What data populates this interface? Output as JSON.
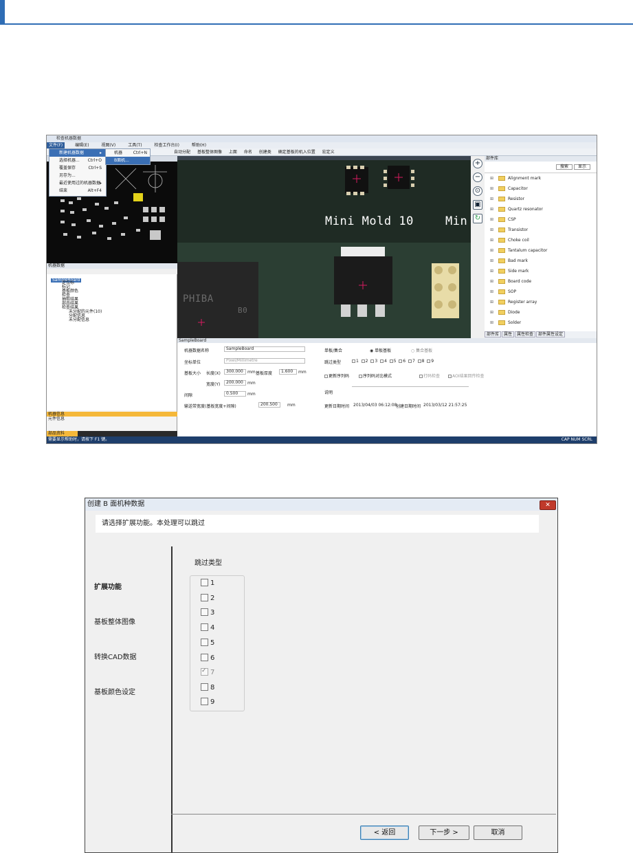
{
  "colors": {
    "accent": "#2f6db5",
    "highlight": "#f5b83a",
    "close_button": "#c0392b"
  },
  "screenshot_top": {
    "app_title": "检查机器数据",
    "menubar": [
      "文件(F)",
      "编辑(E)",
      "视图(V)",
      "工具(T)",
      "检查工作台(I)",
      "帮助(H)"
    ],
    "toolbar": [
      "自动分配",
      "基板整体图像",
      "上面",
      "命名",
      "创建类",
      "确定基板的机入位置",
      "宏定义"
    ],
    "file_menu": [
      {
        "label": "新建机器数据",
        "shortcut": ""
      },
      {
        "label": "选择机器...",
        "shortcut": "Ctrl+O"
      },
      {
        "label": "覆盖保存",
        "shortcut": "Ctrl+S"
      },
      {
        "label": "另存为...",
        "shortcut": ""
      },
      {
        "label": "最近使用过的机器数据",
        "shortcut": ""
      },
      {
        "label": "结束",
        "shortcut": "Alt+F4"
      }
    ],
    "submenu": [
      {
        "label": "机器",
        "shortcut": "Ctrl+N"
      },
      {
        "label": "B面机...",
        "shortcut": ""
      }
    ],
    "tree_panel_title": "机器数据",
    "tree": [
      "SampleBoard",
      "定位标",
      "标记",
      "基板颜色",
      "检查",
      "抽取结果",
      "部品结果",
      "检查结果",
      "未分配的元件(10)",
      "分配信息",
      "未分配信息"
    ],
    "status_panel": {
      "item1": "机器信息",
      "item2": "元件信息"
    },
    "bottom_tab": "部品资料",
    "statusbar_left": "需要显示帮助时，请按下 F1 键。",
    "statusbar_right": "CAP NUM SCRL",
    "silkscreen": [
      "Mini Mold 10",
      "Min",
      "PHIBA",
      "B0"
    ],
    "library_title": "部件库",
    "search_label": "搜索",
    "display_label": "显示",
    "library_items": [
      "Alignment mark",
      "Capacitor",
      "Resistor",
      "Quartz resonator",
      "CSP",
      "Transistor",
      "Choke coil",
      "Tantalum capacitor",
      "Bad mark",
      "Side mark",
      "Board code",
      "SOP",
      "Register array",
      "Diode",
      "Solder"
    ],
    "library_tabs": [
      "部件库",
      "属性",
      "属性检查",
      "部件属性设定"
    ],
    "props_title": "SampleBoard",
    "props": {
      "machine_name_label": "机器数据名称",
      "machine_name": "SampleBoard",
      "unit_label": "坐标单位",
      "unit_value": "Pixel/Millimetre",
      "size_label": "基板大小",
      "length_label": "长度(X)",
      "length_value": "300.000",
      "width_label": "宽度(Y)",
      "width_value": "200.000",
      "thickness_label": "基板厚度",
      "thickness_value": "1.600",
      "mm": "mm",
      "gap_label": "间隙",
      "gap_value": "0.500",
      "min_width_label": "输送带宽度(基板宽度+间隙)",
      "min_width_value": "200.500",
      "single_multi_label": "单板/集合",
      "single_option": "单板基板",
      "multi_option": "集合基板",
      "skip_label": "跳过类型",
      "skip_values": [
        "1",
        "2",
        "3",
        "4",
        "5",
        "6",
        "7",
        "8",
        "9"
      ],
      "opt1": "更新序列码",
      "opt2": "序列码对比模式",
      "opt3": "打码检查",
      "opt4": "AOI结果回传检查",
      "desc_label": "说明",
      "updated_label": "更新日期时间",
      "updated_value": "2013/04/03 06:12:08",
      "created_label": "创建日期时间",
      "created_value": "2013/03/12 21:57:25"
    }
  },
  "dialog": {
    "title": "创建 B 面机种数据",
    "close_symbol": "✕",
    "instruction": "请选择扩展功能。本处理可以跳过",
    "nav": [
      "扩展功能",
      "基板整体图像",
      "转换CAD数据",
      "基板颜色设定"
    ],
    "skip_title": "跳过类型",
    "skip_options": [
      {
        "label": "1",
        "disabled": false
      },
      {
        "label": "2",
        "disabled": false
      },
      {
        "label": "3",
        "disabled": false
      },
      {
        "label": "4",
        "disabled": false
      },
      {
        "label": "5",
        "disabled": false
      },
      {
        "label": "6",
        "disabled": false
      },
      {
        "label": "7",
        "disabled": true
      },
      {
        "label": "8",
        "disabled": false
      },
      {
        "label": "9",
        "disabled": false
      }
    ],
    "buttons": {
      "back": "< 返回",
      "next": "下一步 >",
      "cancel": "取消"
    }
  }
}
